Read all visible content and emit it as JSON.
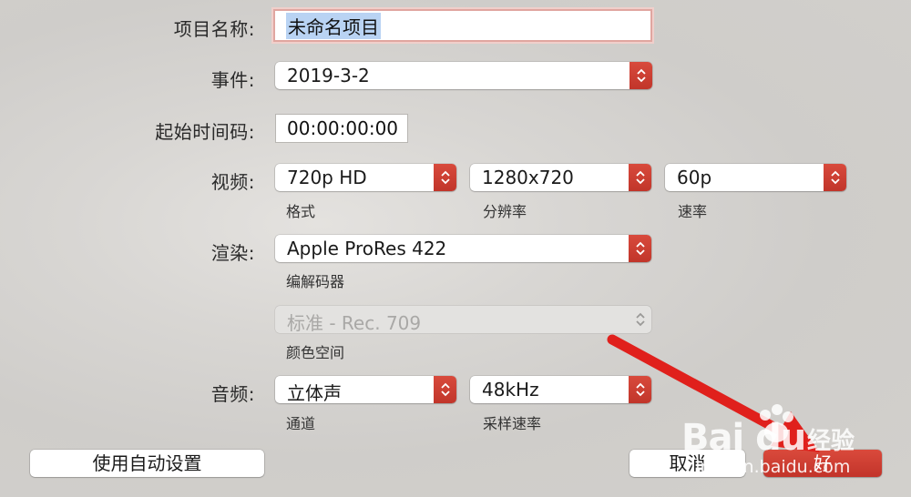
{
  "fields": {
    "project_name": {
      "label": "项目名称:",
      "value": "未命名项目"
    },
    "event": {
      "label": "事件:",
      "value": "2019-3-2"
    },
    "start_timecode": {
      "label": "起始时间码:",
      "value": "00:00:00:00"
    },
    "video": {
      "label": "视频:",
      "format": {
        "value": "720p HD",
        "caption": "格式"
      },
      "resolution": {
        "value": "1280x720",
        "caption": "分辨率"
      },
      "rate": {
        "value": "60p",
        "caption": "速率"
      }
    },
    "render": {
      "label": "渲染:",
      "codec": {
        "value": "Apple ProRes 422",
        "caption": "编解码器"
      },
      "color_space": {
        "value": "标准 - Rec. 709",
        "caption": "颜色空间"
      }
    },
    "audio": {
      "label": "音频:",
      "channels": {
        "value": "立体声",
        "caption": "通道"
      },
      "sample_rate": {
        "value": "48kHz",
        "caption": "采样速率"
      }
    }
  },
  "buttons": {
    "auto_settings": "使用自动设置",
    "cancel": "取消",
    "ok": "好"
  },
  "watermark": {
    "logo": "Bai  du",
    "brand": "经验",
    "url": "jingyan.baidu.com"
  },
  "colors": {
    "accent": "#c9392d",
    "selection": "#b9d3f3"
  }
}
